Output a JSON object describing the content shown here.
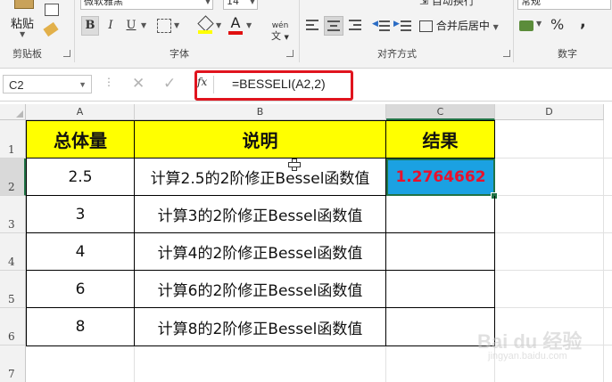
{
  "ribbon": {
    "clipboard": {
      "paste_label": "粘贴",
      "group_label": "剪贴板"
    },
    "font": {
      "font_name": "微软雅黑",
      "font_size": "14",
      "bold": "B",
      "italic": "I",
      "underline": "U",
      "phonetic": "wén",
      "group_label": "字体"
    },
    "alignment": {
      "merge_center_label": "合并后居中",
      "wrap_text_label": "自动换行",
      "group_label": "对齐方式"
    },
    "number": {
      "format_label": "常规",
      "percent": "%",
      "comma": ",",
      "group_label": "数字"
    }
  },
  "formula_bar": {
    "name_box": "C2",
    "fx_label": "fx",
    "formula": "=BESSELI(A2,2)"
  },
  "sheet": {
    "columns": [
      "A",
      "B",
      "C",
      "D"
    ],
    "rows": [
      "1",
      "2",
      "3",
      "4",
      "5",
      "6",
      "7"
    ],
    "header": [
      "总体量",
      "说明",
      "结果"
    ],
    "data": [
      [
        "2.5",
        "计算2.5的2阶修正Bessel函数值",
        "1.2764662"
      ],
      [
        "3",
        "计算3的2阶修正Bessel函数值",
        ""
      ],
      [
        "4",
        "计算4的2阶修正Bessel函数值",
        ""
      ],
      [
        "6",
        "计算6的2阶修正Bessel函数值",
        ""
      ],
      [
        "8",
        "计算8的2阶修正Bessel函数值",
        ""
      ]
    ]
  },
  "watermark": {
    "brand": "Bai du 经验",
    "url": "jingyan.baidu.com"
  },
  "colors": {
    "header_fill": "#ffff00",
    "selected_fill": "#1ba1e2",
    "result_text": "#e8112d",
    "highlight_frame": "#e0141e"
  }
}
